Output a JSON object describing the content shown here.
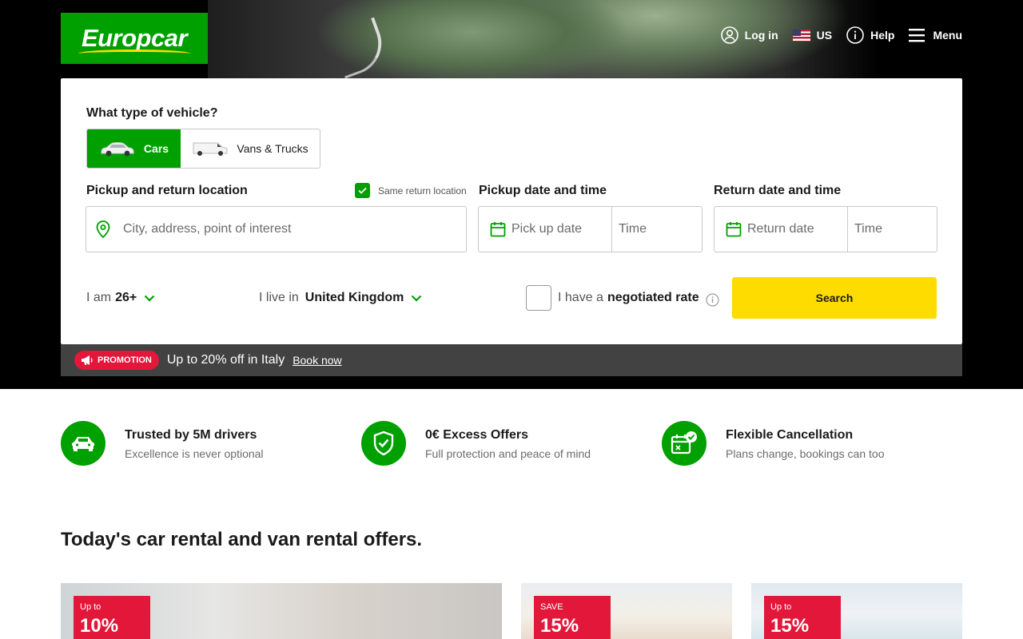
{
  "header": {
    "logo_text": "Europcar",
    "nav": [
      {
        "label": "Log in",
        "icon": "user-icon"
      },
      {
        "label": "US",
        "icon": "us-flag-icon"
      },
      {
        "label": "Help",
        "icon": "info-icon"
      },
      {
        "label": "Menu",
        "icon": "hamburger-icon"
      }
    ]
  },
  "booking": {
    "vehicle_question": "What type of vehicle?",
    "vehicle_options": [
      {
        "label": "Cars",
        "selected": true
      },
      {
        "label": "Vans & Trucks",
        "selected": false
      }
    ],
    "location_label": "Pickup and return location",
    "same_return_label": "Same return location",
    "same_return_checked": true,
    "location_placeholder": "City, address, point of interest",
    "pickup_label": "Pickup date and time",
    "pickup_date_placeholder": "Pick up date",
    "pickup_time_placeholder": "Time",
    "return_label": "Return date and time",
    "return_date_placeholder": "Return date",
    "return_time_placeholder": "Time",
    "age_prefix": "I am",
    "age_value": "26+",
    "residence_prefix": "I live in",
    "residence_value": "United Kingdom",
    "negotiated_prefix": "I have a",
    "negotiated_bold": "negotiated rate",
    "search_label": "Search"
  },
  "promo": {
    "badge": "PROMOTION",
    "text": "Up to 20% off in Italy",
    "link": "Book now"
  },
  "features": [
    {
      "title": "Trusted by 5M drivers",
      "subtitle": "Excellence is never optional",
      "icon": "car-icon"
    },
    {
      "title": "0€ Excess Offers",
      "subtitle": "Full protection and peace of mind",
      "icon": "shield-check-icon"
    },
    {
      "title": "Flexible Cancellation",
      "subtitle": "Plans change, bookings can too",
      "icon": "calendar-check-icon"
    }
  ],
  "offers": {
    "title": "Today's car rental and van rental offers.",
    "cards": [
      {
        "tag_top": "Up to",
        "tag_value": "10%"
      },
      {
        "tag_top": "SAVE",
        "tag_value": "15%"
      },
      {
        "tag_top": "Up to",
        "tag_value": "15%"
      }
    ]
  },
  "colors": {
    "brand_green": "#00a000",
    "search_yellow": "#ffdc00",
    "promo_red": "#e2173a"
  }
}
